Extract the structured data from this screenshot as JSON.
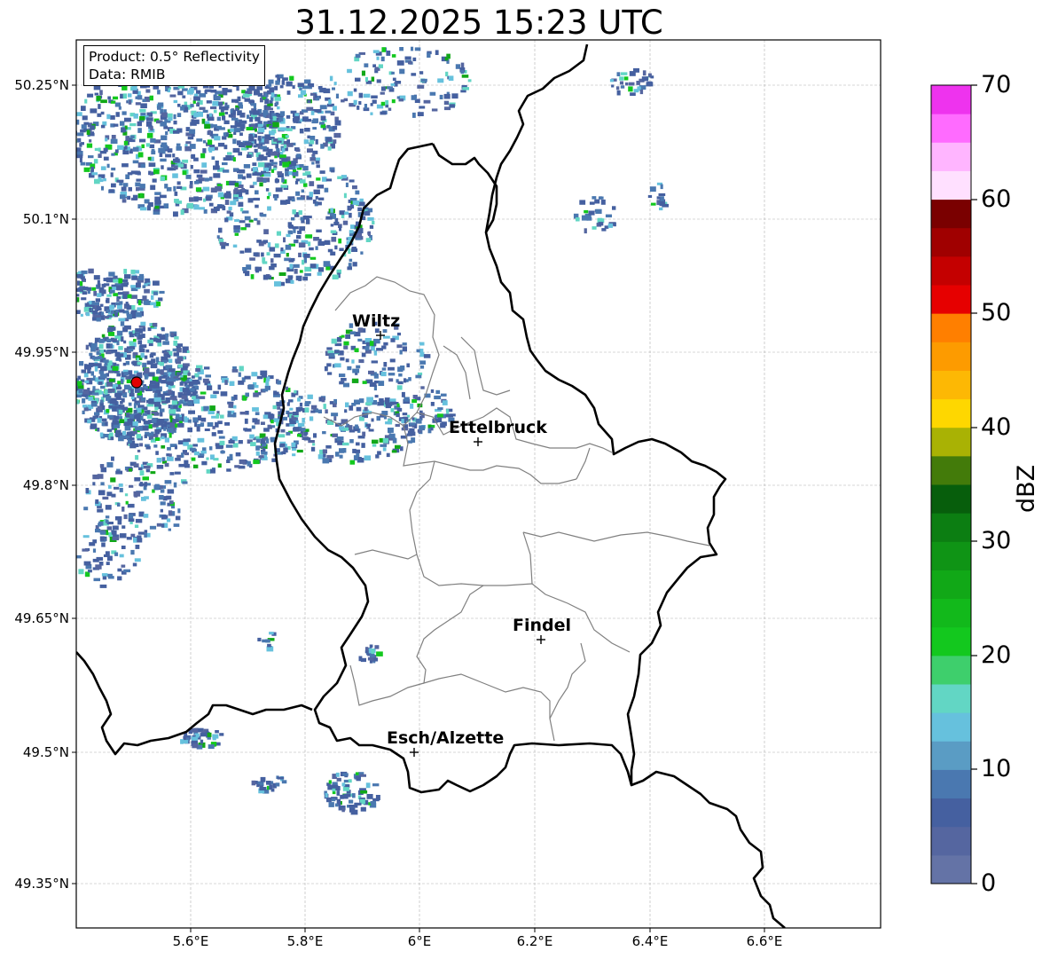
{
  "title": "31.12.2025 15:23 UTC",
  "info_box": {
    "product": "Product: 0.5° Reflectivity",
    "data": "Data: RMIB"
  },
  "axes": {
    "lat_range": [
      49.3,
      50.3
    ],
    "lon_range": [
      5.4,
      6.8
    ],
    "lat_ticks": [
      "50.25°N",
      "50.1°N",
      "49.95°N",
      "49.8°N",
      "49.65°N",
      "49.5°N",
      "49.35°N"
    ],
    "lon_ticks": [
      "5.6°E",
      "5.8°E",
      "6°E",
      "6.2°E",
      "6.4°E",
      "6.6°E"
    ],
    "grid": true
  },
  "cities": [
    {
      "name": "Wiltz",
      "lon": 5.935,
      "lat": 49.967
    },
    {
      "name": "Ettelbruck",
      "lon": 6.104,
      "lat": 49.848
    },
    {
      "name": "Findel",
      "lon": 6.21,
      "lat": 49.625
    },
    {
      "name": "Esch/Alzette",
      "lon": 5.99,
      "lat": 49.498
    }
  ],
  "radar_site": {
    "lon": 5.505,
    "lat": 49.915,
    "color": "#e00000"
  },
  "colorbar": {
    "label": "dBZ",
    "min": 0,
    "max": 70,
    "ticks": [
      "0",
      "10",
      "20",
      "30",
      "40",
      "50",
      "60",
      "70"
    ],
    "colors": [
      "#6473a6",
      "#5566a0",
      "#4560a0",
      "#4a78b0",
      "#5a9cc4",
      "#66c1dd",
      "#62d6c4",
      "#3ecf6c",
      "#13c81e",
      "#12b91b",
      "#11a817",
      "#0f9415",
      "#0c7e12",
      "#075e0c",
      "#437b0a",
      "#a9b204",
      "#fed700",
      "#fdb804",
      "#fd9b00",
      "#ff7f00",
      "#e60000",
      "#c40000",
      "#a00000",
      "#7a0000",
      "#ffe0ff",
      "#ffb5ff",
      "#ff6bff",
      "#ee33ee"
    ]
  }
}
